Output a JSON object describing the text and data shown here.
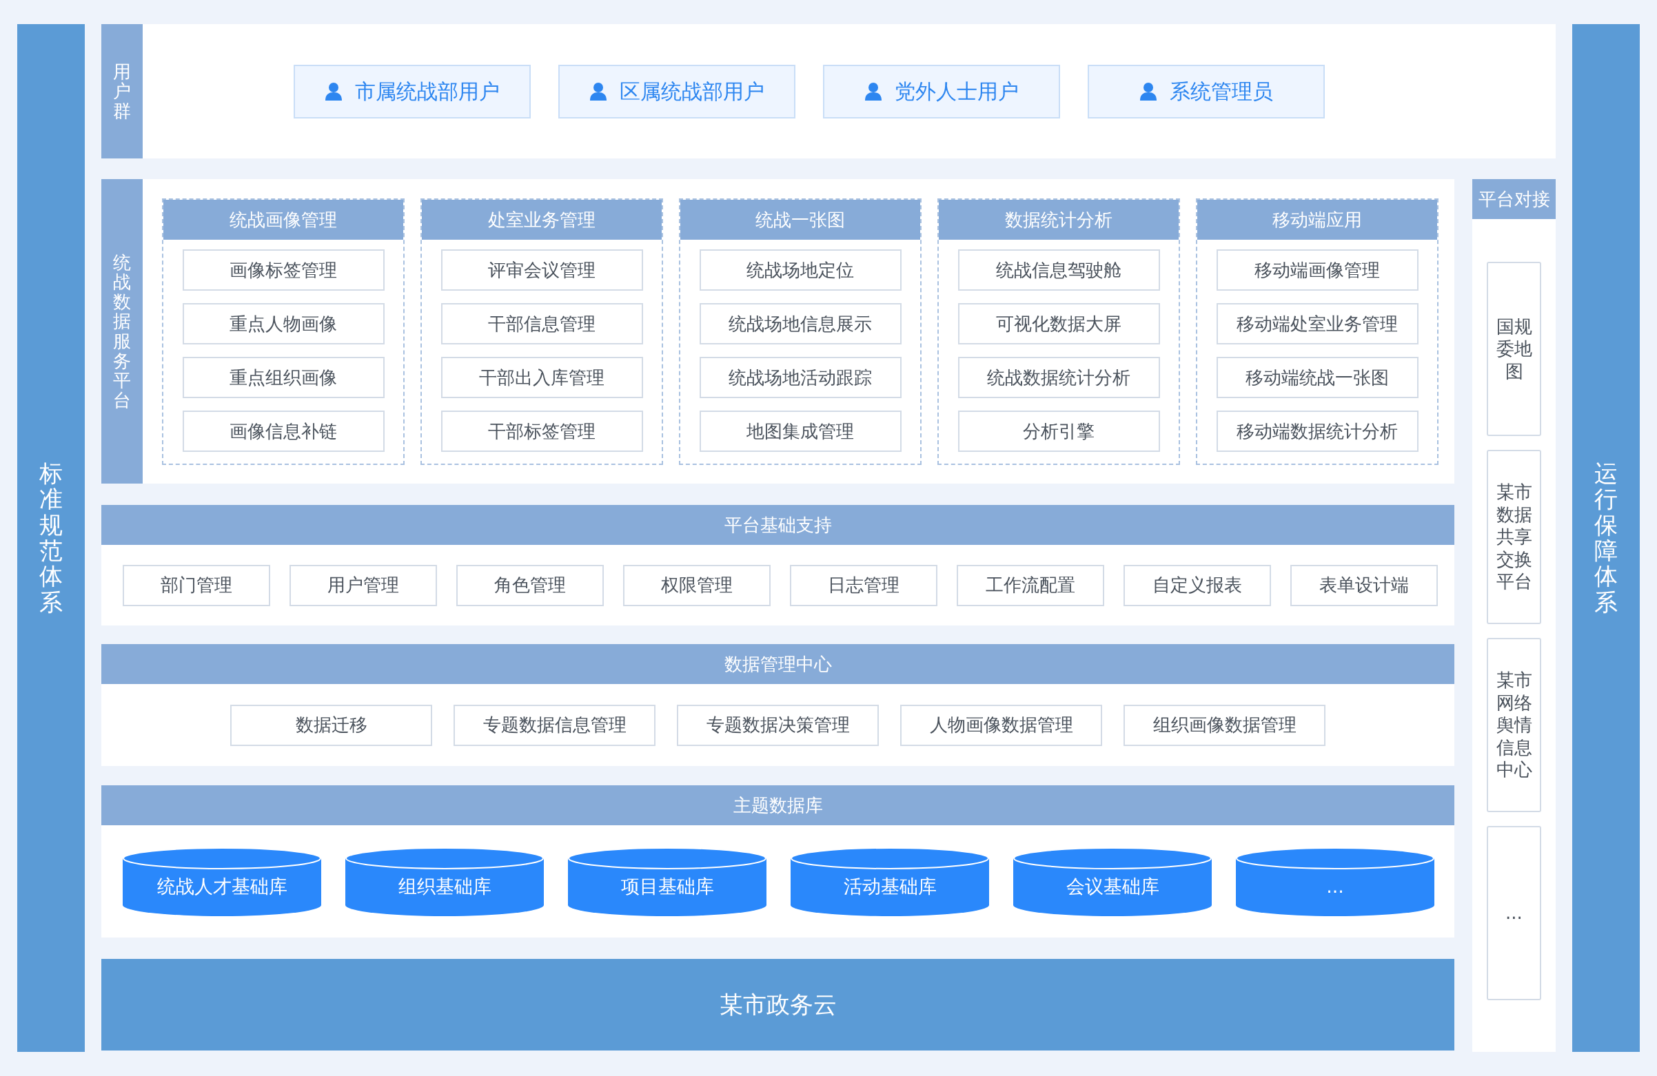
{
  "side_left": {
    "label": "标准规范体系"
  },
  "side_right": {
    "label": "运行保障体系"
  },
  "user_group": {
    "label": "用户群",
    "users": [
      {
        "label": "市属统战部用户"
      },
      {
        "label": "区属统战部用户"
      },
      {
        "label": "党外人士用户"
      },
      {
        "label": "系统管理员"
      }
    ]
  },
  "platform": {
    "label": "统战数据服务平台",
    "modules": [
      {
        "title": "统战画像管理",
        "items": [
          "画像标签管理",
          "重点人物画像",
          "重点组织画像",
          "画像信息补链"
        ]
      },
      {
        "title": "处室业务管理",
        "items": [
          "评审会议管理",
          "干部信息管理",
          "干部出入库管理",
          "干部标签管理"
        ]
      },
      {
        "title": "统战一张图",
        "items": [
          "统战场地定位",
          "统战场地信息展示",
          "统战场地活动跟踪",
          "地图集成管理"
        ]
      },
      {
        "title": "数据统计分析",
        "items": [
          "统战信息驾驶舱",
          "可视化数据大屏",
          "统战数据统计分析",
          "分析引擎"
        ]
      },
      {
        "title": "移动端应用",
        "items": [
          "移动端画像管理",
          "移动端处室业务管理",
          "移动端统战一张图",
          "移动端数据统计分析"
        ]
      }
    ]
  },
  "platform_docking": {
    "title": "平台对接",
    "items": [
      "国规委地图",
      "某市数据共享交换平台",
      "某市网络舆情信息中心",
      "..."
    ]
  },
  "base_support": {
    "title": "平台基础支持",
    "items": [
      "部门管理",
      "用户管理",
      "角色管理",
      "权限管理",
      "日志管理",
      "工作流配置",
      "自定义报表",
      "表单设计端"
    ]
  },
  "data_center": {
    "title": "数据管理中心",
    "items": [
      "数据迁移",
      "专题数据信息管理",
      "专题数据决策管理",
      "人物画像数据管理",
      "组织画像数据管理"
    ]
  },
  "theme_db": {
    "title": "主题数据库",
    "databases": [
      "统战人才基础库",
      "组织基础库",
      "项目基础库",
      "活动基础库",
      "会议基础库",
      "..."
    ]
  },
  "cloud": {
    "label": "某市政务云"
  }
}
